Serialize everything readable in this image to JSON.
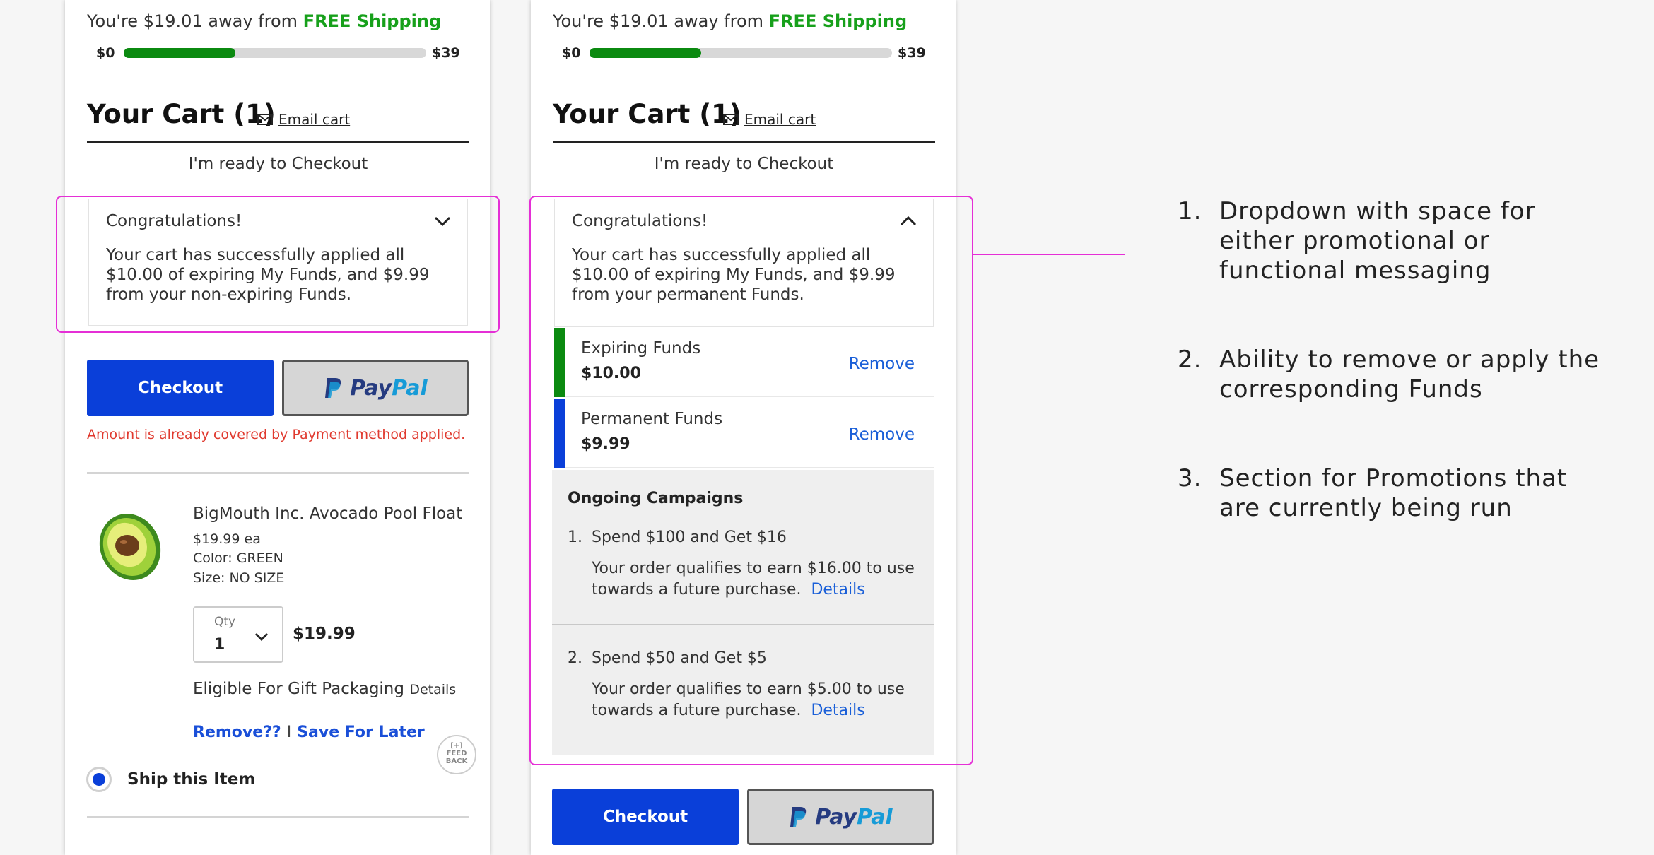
{
  "shipping": {
    "msg_prefix": "You're $19.01 away from",
    "msg_free": "FREE Shipping",
    "min_label": "$0",
    "max_label": "$39",
    "progress_fraction": 0.37,
    "progress_color": "#0b8a10"
  },
  "cart": {
    "title": "Your Cart (1)",
    "email_label": "Email cart",
    "ready_label": "I'm ready to Checkout"
  },
  "left": {
    "congrats_title": "Congratulations!",
    "congrats_body": "Your cart has successfully applied all $10.00 of expiring My Funds, and $9.99 from your non-expiring Funds.",
    "checkout_label": "Checkout",
    "paypal_label_1": "Pay",
    "paypal_label_2": "Pal",
    "error_msg": "Amount is already covered by Payment method applied.",
    "product": {
      "name": "BigMouth Inc. Avocado Pool Float",
      "price_each": "$19.99 ea",
      "color": "Color: GREEN",
      "size": "Size: NO SIZE",
      "qty_label": "Qty",
      "qty_value": "1",
      "line_price": "$19.99",
      "gift_label": "Eligible For Gift Packaging",
      "gift_details": "Details",
      "remove_label": "Remove??",
      "separator": "I",
      "save_label": "Save For Later"
    },
    "feedback_mark": "[+]",
    "feedback_line1": "FEED",
    "feedback_line2": "BACK",
    "ship_item_label": "Ship this Item"
  },
  "right": {
    "congrats_title": "Congratulations!",
    "congrats_body": "Your cart has successfully applied all $10.00 of expiring My Funds, and $9.99 from your permanent Funds.",
    "funds": [
      {
        "name": "Expiring Funds",
        "amount": "$10.00",
        "action": "Remove",
        "color": "#0b8a10"
      },
      {
        "name": "Permanent Funds",
        "amount": "$9.99",
        "action": "Remove",
        "color": "#0a3fd9"
      }
    ],
    "campaigns_title": "Ongoing Campaigns",
    "campaigns": [
      {
        "num": "1.",
        "title": "Spend $100 and Get $16",
        "desc": "Your order qualifies to earn $16.00 to use towards a future purchase.",
        "details": "Details"
      },
      {
        "num": "2.",
        "title": "Spend $50 and Get $5",
        "desc": "Your order qualifies to earn $5.00 to use towards a future purchase.",
        "details": "Details"
      }
    ],
    "checkout_label": "Checkout",
    "paypal_label_1": "Pay",
    "paypal_label_2": "Pal"
  },
  "notes": [
    {
      "num": "1.",
      "text": "Dropdown with space for either promotional or functional messaging"
    },
    {
      "num": "2.",
      "text": "Ability to remove or apply the corresponding Funds"
    },
    {
      "num": "3.",
      "text": "Section for Promotions that are currently being run"
    }
  ],
  "colors": {
    "primary_blue": "#0a3fd9",
    "free_green": "#17a01b",
    "error_red": "#e03a2f",
    "annotation_pink": "#e52fd6",
    "link_blue": "#1a5fd8"
  },
  "icons": [
    "mail-icon",
    "chevron-down-icon",
    "chevron-up-icon",
    "paypal-logo",
    "avocado-image",
    "radio-selected-icon"
  ]
}
